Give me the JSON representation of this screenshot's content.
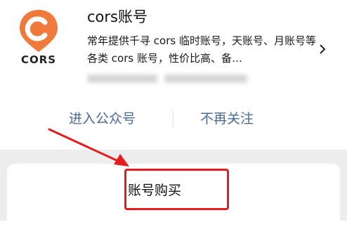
{
  "account": {
    "name": "cors账号",
    "description": "常年提供千寻 cors 临时账号，天账号、月账号等各类 cors 账号，性价比高、备…",
    "logo_text": "CORS"
  },
  "actions": {
    "enter_label": "进入公众号",
    "unfollow_label": "不再关注"
  },
  "menu": {
    "buy_label": "账号购买"
  },
  "colors": {
    "logo_orange": "#f07a3c",
    "link_blue": "#4a6a95",
    "annotation_red": "#e41e1e",
    "band_gray": "#ededed"
  },
  "icons": {
    "chevron": "chevron-right-icon",
    "logo": "cors-location-pin-logo"
  }
}
